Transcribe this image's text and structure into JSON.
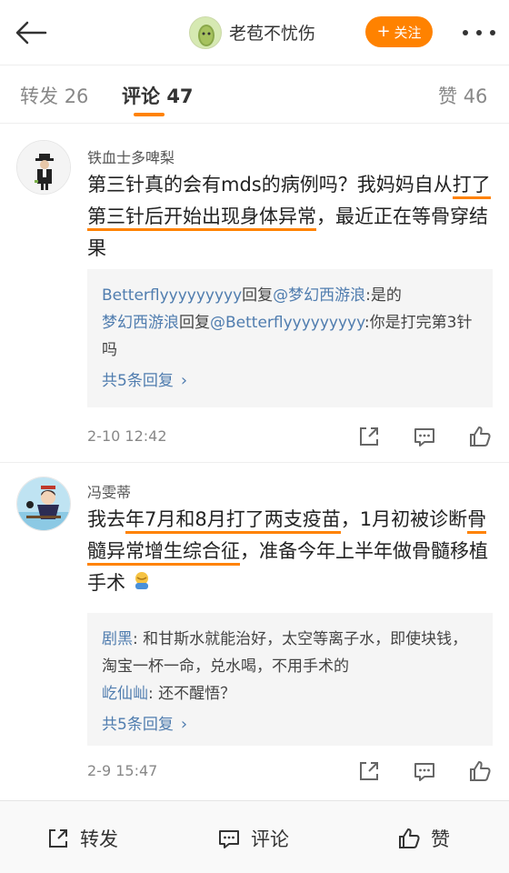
{
  "header": {
    "back_icon": "arrow-left-icon",
    "author_name": "老苞不忧伤",
    "follow_label": "关注",
    "follow_color": "#ff8200",
    "more_icon": "more-dots-icon"
  },
  "tabs": {
    "repost": {
      "label": "转发",
      "count": "26"
    },
    "comments": {
      "label": "评论",
      "count": "47"
    },
    "likes": {
      "label": "赞",
      "count": "46"
    }
  },
  "comments": [
    {
      "user": "铁血士多啤梨",
      "text_before": "第三针真的会有mds的病例吗？我妈妈自从",
      "text_hl": "打了第三针后开始出现身体异常",
      "text_after": "，最近正在等骨穿结果",
      "replies": [
        {
          "user": "Betterflyyyyyyyyy",
          "verb": "回复",
          "target": "@梦幻西游浪",
          "text": ":是的"
        },
        {
          "user": "梦幻西游浪",
          "verb": "回复",
          "target": "@Betterflyyyyyyyyy",
          "text": ":你是打完第3针吗"
        }
      ],
      "more_replies": "共5条回复",
      "time": "2-10 12:42"
    },
    {
      "user": "冯雯蒂",
      "text_a": "我去",
      "text_hl1": "年7月和8月打了两支疫苗",
      "text_b": "，1月初被诊断",
      "text_hl2": "骨髓异常增生综合征",
      "text_c": "，准备今年上半年做骨髓移植手术",
      "replies": [
        {
          "user": "剧黑",
          "text": ": 和甘斯水就能治好，太空等离子水，即使块钱，淘宝一杯一命，兑水喝，不用手术的"
        },
        {
          "user": "屹仙屾",
          "text": ": 还不醒悟？"
        }
      ],
      "more_replies": "共5条回复",
      "time": "2-9 15:47"
    }
  ],
  "footer": {
    "repost_label": "转发",
    "comment_label": "评论",
    "like_label": "赞"
  }
}
